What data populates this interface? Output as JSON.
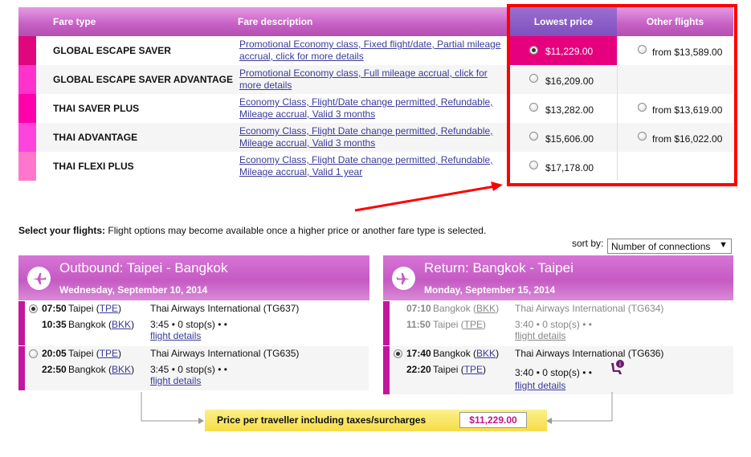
{
  "fare_table": {
    "headers": {
      "fare_type": "Fare type",
      "fare_description": "Fare description",
      "lowest_price": "Lowest price",
      "other_flights": "Other flights"
    },
    "rows": [
      {
        "name": "GLOBAL ESCAPE SAVER",
        "desc1": "Promotional Economy class, Fixed flight/date, Partial mileage",
        "desc2": "accrual, click for more details",
        "lowest": "$11,229.00",
        "other": "from $13,589.00",
        "swatch": "#e0067e",
        "lowest_selected": true
      },
      {
        "name": "GLOBAL ESCAPE SAVER ADVANTAGE",
        "desc1": "Promotional Economy class, Full mileage accrual, click for",
        "desc2": "more details",
        "lowest": "$16,209.00",
        "other": "",
        "swatch": "#ff33cc",
        "lowest_selected": false
      },
      {
        "name": "THAI SAVER PLUS",
        "desc1": "Economy Class, Flight/Date change permitted, Refundable,",
        "desc2": "Mileage accrual, Valid 3 months",
        "lowest": "$13,282.00",
        "other": "from $13,619.00",
        "swatch": "#ff00aa",
        "lowest_selected": false
      },
      {
        "name": "THAI ADVANTAGE",
        "desc1": "Economy Class, Flight Date change permitted, Refundable,",
        "desc2": "Mileage accrual, Valid 3 months",
        "lowest": "$15,606.00",
        "other": "from $16,022.00",
        "swatch": "#ff44dd",
        "lowest_selected": false
      },
      {
        "name": "THAI FLEXI PLUS",
        "desc1": "Economy Class, Flight Date change permitted, Refundable,",
        "desc2": "Mileage accrual, Valid 1 year",
        "lowest": "$17,178.00",
        "other": "",
        "swatch": "#ff77cc",
        "lowest_selected": false
      }
    ]
  },
  "select_flights": {
    "label": "Select your flights:",
    "note": " Flight options may become available once a higher price or another fare type is selected.",
    "sort_label": "sort by:",
    "sort_value": "Number of connections",
    "sort_arrow": "▼"
  },
  "outbound": {
    "title": "Outbound: Taipei - Bangkok",
    "date": "Wednesday, September 10, 2014",
    "flights": [
      {
        "dep_time": "07:50",
        "dep_city": "Taipei",
        "dep_code": "TPE",
        "arr_time": "10:35",
        "arr_city": "Bangkok",
        "arr_code": "BKK",
        "airline": "Thai Airways International (TG637)",
        "duration": "3:45",
        "stops": "0 stop(s)",
        "details": "flight details",
        "checked": true
      },
      {
        "dep_time": "20:05",
        "dep_city": "Taipei",
        "dep_code": "TPE",
        "arr_time": "22:50",
        "arr_city": "Bangkok",
        "arr_code": "BKK",
        "airline": "Thai Airways International (TG635)",
        "duration": "3:45",
        "stops": "0 stop(s)",
        "details": "flight details",
        "checked": false
      }
    ]
  },
  "return": {
    "title": "Return: Bangkok - Taipei",
    "date": "Monday, September 15, 2014",
    "flights": [
      {
        "dep_time": "07:10",
        "dep_city": "Bangkok",
        "dep_code": "BKK",
        "arr_time": "11:50",
        "arr_city": "Taipei",
        "arr_code": "TPE",
        "airline": "Thai Airways International (TG634)",
        "duration": "3:40",
        "stops": "0 stop(s)",
        "details": "flight details",
        "checked": false,
        "disabled": true
      },
      {
        "dep_time": "17:40",
        "dep_city": "Bangkok",
        "dep_code": "BKK",
        "arr_time": "22:20",
        "arr_city": "Taipei",
        "arr_code": "TPE",
        "airline": "Thai Airways International (TG636)",
        "duration": "3:40",
        "stops": "0 stop(s)",
        "details": "flight details",
        "checked": true,
        "disabled": false
      }
    ]
  },
  "price": {
    "label": "Price per traveller including taxes/surcharges",
    "total": "$11,229.00"
  },
  "colors": {
    "accent": "#c3169f",
    "highlight": "#ff0000",
    "price_bar": "#f6dd48"
  }
}
